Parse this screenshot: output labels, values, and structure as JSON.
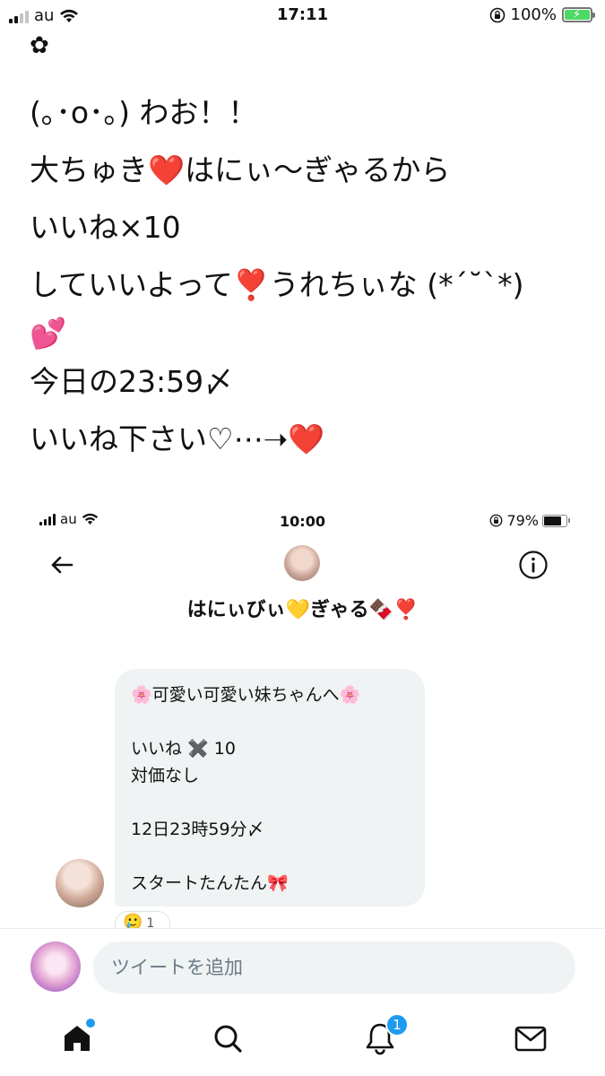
{
  "status_bar": {
    "carrier": "au",
    "time": "17:11",
    "battery": "100%"
  },
  "tweet": {
    "lines": [
      "(｡･o･｡) わお！！",
      "大ちゅき❤️はにぃ〜ぎゃるから",
      "いいね×10",
      "していいよって❣️うれちぃな (*´˘`*)",
      "💕",
      "今日の23:59〆",
      "いいね下さい♡⋯➝❤️"
    ]
  },
  "embedded": {
    "status_bar": {
      "carrier": "au",
      "time": "10:00",
      "battery": "79%"
    },
    "conversation_name": "はにぃびぃ💛ぎゃる🍫❣️",
    "message_lines": [
      "🌸可愛い可愛い妹ちゃんへ🌸",
      "",
      "いいね ✖️ 10",
      "対価なし",
      "",
      "12日23時59分〆",
      "",
      "スタートたんたん🎀"
    ],
    "reaction": {
      "emoji": "🥲",
      "count": "1"
    }
  },
  "composer": {
    "placeholder": "ツイートを追加"
  },
  "tabs": {
    "notification_count": "1"
  },
  "colors": {
    "accent": "#1d9bf0",
    "bubble": "#eff3f4",
    "heart": "#e3203a",
    "battery_green": "#4cd964"
  },
  "icons": [
    "flower-icon",
    "back-arrow-icon",
    "info-icon",
    "home-icon",
    "search-icon",
    "bell-icon",
    "mail-icon",
    "wifi-icon",
    "battery-icon",
    "rotation-lock-icon"
  ]
}
